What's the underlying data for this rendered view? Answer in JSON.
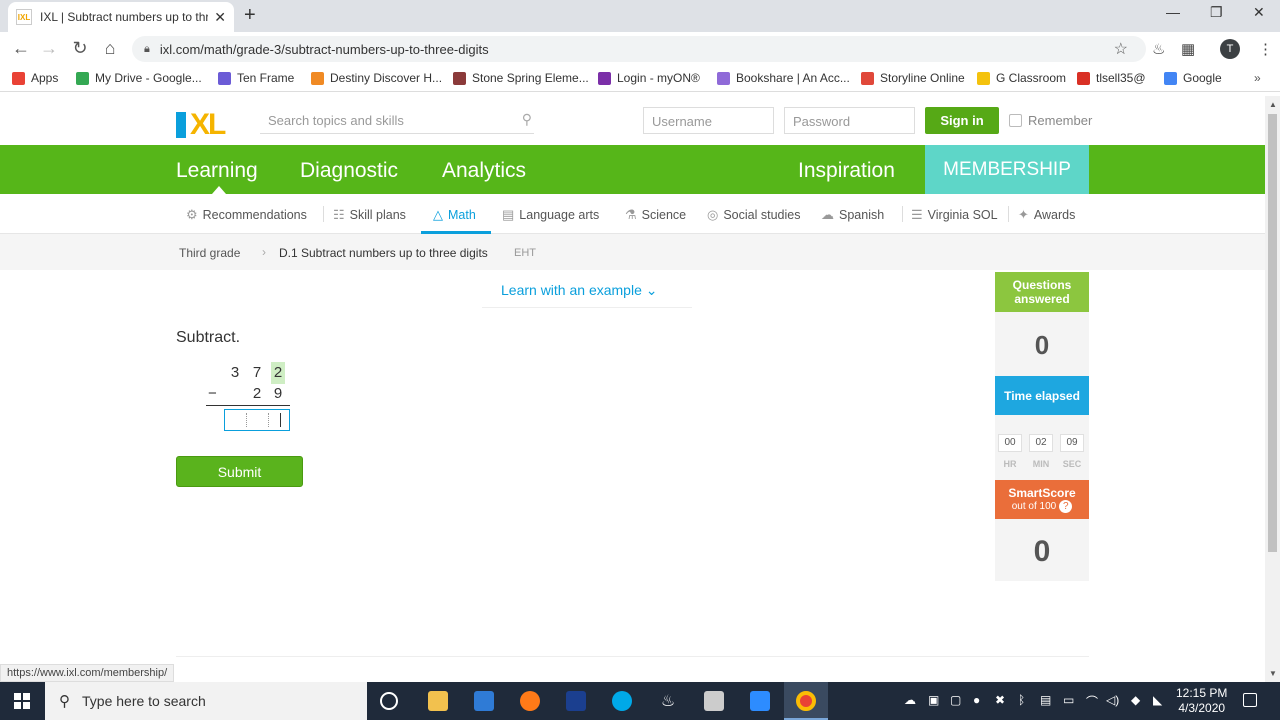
{
  "browser": {
    "tab_title": "IXL | Subtract numbers up to three",
    "url": "ixl.com/math/grade-3/subtract-numbers-up-to-three-digits",
    "status_url": "https://www.ixl.com/membership/",
    "profile_initial": "T",
    "bookmarks": [
      {
        "label": "Apps",
        "color": "#e94235"
      },
      {
        "label": "My Drive - Google...",
        "color": "#34a853"
      },
      {
        "label": "Ten Frame",
        "color": "#6b5bd6"
      },
      {
        "label": "Destiny Discover H...",
        "color": "#f08a24"
      },
      {
        "label": "Stone Spring Eleme...",
        "color": "#8b3a3a"
      },
      {
        "label": "Login - myON®",
        "color": "#7b2fa8"
      },
      {
        "label": "Bookshare | An Acc...",
        "color": "#8f6ad8"
      },
      {
        "label": "Storyline Online",
        "color": "#e0483a"
      },
      {
        "label": "G Classroom",
        "color": "#f4c20d"
      },
      {
        "label": "tlsell35@",
        "color": "#d93025"
      },
      {
        "label": "Google",
        "color": "#4285f4"
      }
    ]
  },
  "header": {
    "logo": "IXL",
    "search_placeholder": "Search topics and skills",
    "username_placeholder": "Username",
    "password_placeholder": "Password",
    "signin_label": "Sign in",
    "remember_label": "Remember"
  },
  "mainnav": {
    "learning": "Learning",
    "diagnostic": "Diagnostic",
    "analytics": "Analytics",
    "inspiration": "Inspiration",
    "membership": "MEMBERSHIP"
  },
  "subnav": {
    "recommendations": "Recommendations",
    "skill_plans": "Skill plans",
    "math": "Math",
    "language_arts": "Language arts",
    "science": "Science",
    "social_studies": "Social studies",
    "spanish": "Spanish",
    "virginia_sol": "Virginia SOL",
    "awards": "Awards"
  },
  "breadcrumb": {
    "grade": "Third grade",
    "skill": "D.1 Subtract numbers up to three digits",
    "code": "EHT"
  },
  "problem": {
    "learn_link": "Learn with an example",
    "prompt": "Subtract.",
    "top_digits": [
      "3",
      "7",
      "2"
    ],
    "bottom_digits": [
      "2",
      "9"
    ],
    "operator": "−",
    "submit_label": "Submit"
  },
  "stats": {
    "questions_label": "Questions answered",
    "questions_value": "0",
    "time_label": "Time elapsed",
    "time_hr": "00",
    "time_min": "02",
    "time_sec": "09",
    "hr_label": "HR",
    "min_label": "MIN",
    "sec_label": "SEC",
    "smartscore_label": "SmartScore",
    "smartscore_sub": "out of 100",
    "smartscore_value": "0",
    "help_glyph": "?"
  },
  "taskbar": {
    "search_placeholder": "Type here to search",
    "time": "12:15 PM",
    "date": "4/3/2020"
  },
  "colors": {
    "ixl_green": "#56b619",
    "membership_teal": "#5ed6c8",
    "questions_green": "#8cc63f",
    "time_blue": "#1ea7e0",
    "smartscore_orange": "#ea6e3a"
  }
}
